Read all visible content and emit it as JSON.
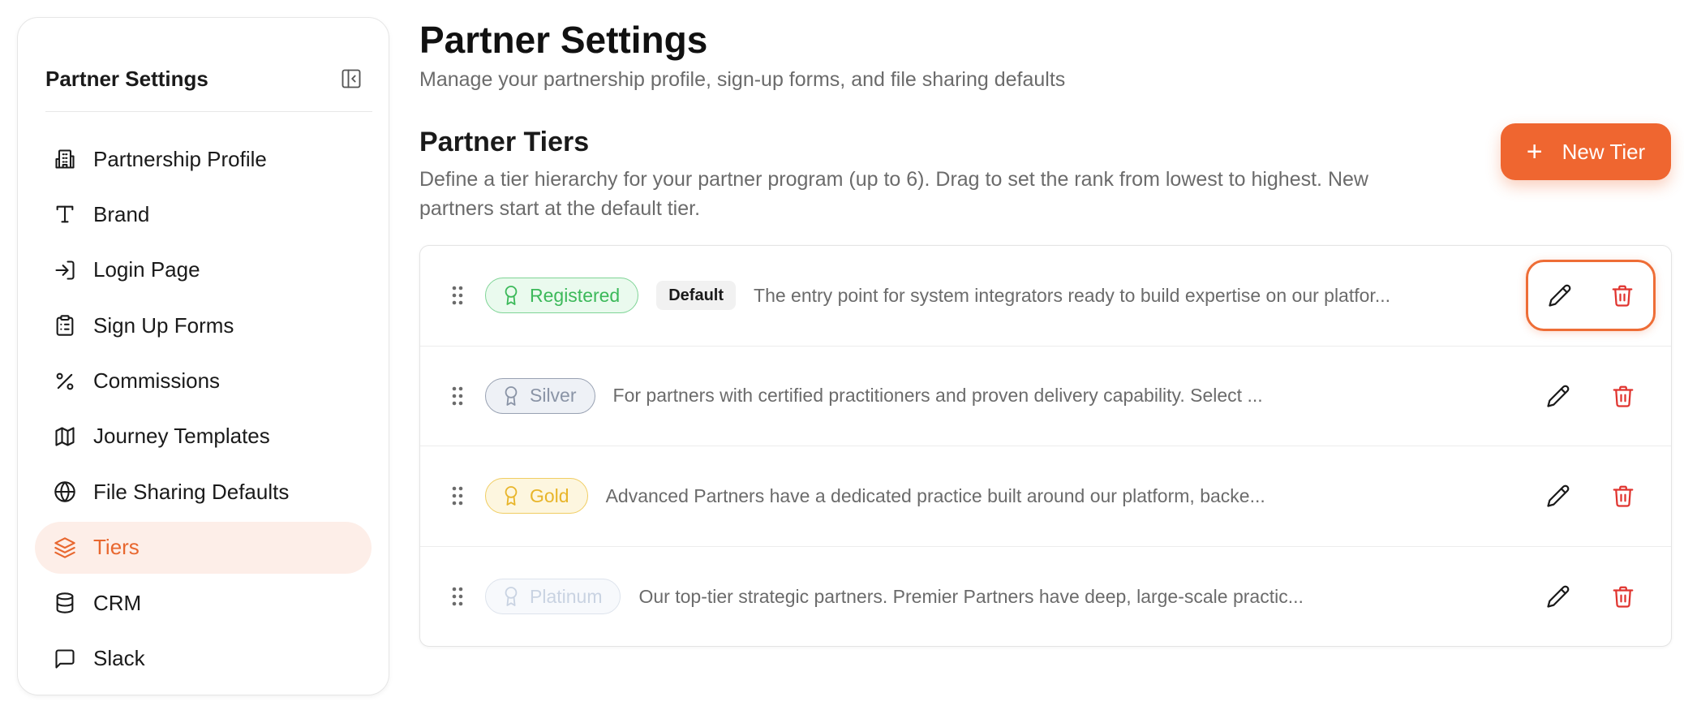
{
  "sidebar": {
    "title": "Partner Settings",
    "collapse_icon": "sidebar-collapse-icon",
    "items": [
      {
        "label": "Partnership Profile",
        "icon": "building-icon",
        "active": false
      },
      {
        "label": "Brand",
        "icon": "type-icon",
        "active": false
      },
      {
        "label": "Login Page",
        "icon": "login-icon",
        "active": false
      },
      {
        "label": "Sign Up Forms",
        "icon": "clipboard-icon",
        "active": false
      },
      {
        "label": "Commissions",
        "icon": "percent-icon",
        "active": false
      },
      {
        "label": "Journey Templates",
        "icon": "map-icon",
        "active": false
      },
      {
        "label": "File Sharing Defaults",
        "icon": "globe-icon",
        "active": false
      },
      {
        "label": "Tiers",
        "icon": "layers-icon",
        "active": true
      },
      {
        "label": "CRM",
        "icon": "database-icon",
        "active": false
      },
      {
        "label": "Slack",
        "icon": "message-square-icon",
        "active": false
      }
    ]
  },
  "header": {
    "title": "Partner Settings",
    "subtitle": "Manage your partnership profile, sign-up forms, and file sharing defaults"
  },
  "section": {
    "title": "Partner Tiers",
    "description": "Define a tier hierarchy for your partner program (up to 6). Drag to set the rank from lowest to highest. New partners start at the default tier.",
    "new_button_label": "New Tier"
  },
  "tiers": [
    {
      "name": "Registered",
      "is_default": true,
      "default_label": "Default",
      "description": "The entry point for system integrators ready to build expertise on our platfor...",
      "color": "#3cb95a",
      "bg": "#eafaee",
      "border": "#7fd496"
    },
    {
      "name": "Silver",
      "is_default": false,
      "description": "For partners with certified practitioners and proven delivery capability. Select ...",
      "color": "#8a94a6",
      "bg": "#eef1f6",
      "border": "#98a1b2"
    },
    {
      "name": "Gold",
      "is_default": false,
      "description": "Advanced Partners have a dedicated practice built around our platform, backe...",
      "color": "#e8b52a",
      "bg": "#fdf6df",
      "border": "#f0cd62"
    },
    {
      "name": "Platinum",
      "is_default": false,
      "description": "Our top-tier strategic partners. Premier Partners have deep, large-scale practic...",
      "color": "#c9d3e2",
      "bg": "#f7f9fc",
      "border": "#dde3ec"
    }
  ],
  "colors": {
    "accent": "#ef6630",
    "danger": "#e0342f"
  }
}
